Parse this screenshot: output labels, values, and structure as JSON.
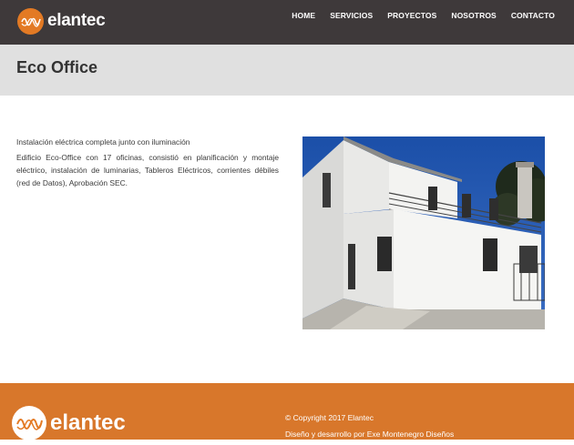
{
  "header": {
    "brand": "elantec",
    "nav": [
      "HOME",
      "SERVICIOS",
      "PROYECTOS",
      "NOSOTROS",
      "CONTACTO"
    ]
  },
  "page": {
    "title": "Eco Office"
  },
  "content": {
    "subtitle": "Instalación eléctrica completa junto con iluminación",
    "body": "Edificio Eco-Office con 17 oficinas, consistió en planificación y montaje eléctrico, instalación de luminarias, Tableros Eléctricos, corrientes débiles (red de Datos), Aprobación SEC."
  },
  "footer": {
    "brand": "elantec",
    "copyright": "© Copyright 2017 Elantec",
    "credits": "Diseño y desarrollo por Exe Montenegro Diseños"
  },
  "colors": {
    "header_bg": "#3e393a",
    "accent": "#e37a24",
    "title_bar_bg": "#e0e0e0",
    "footer_bg": "#d8772b"
  },
  "icons": [
    "elantec-logo-icon",
    "elantec-footer-logo-icon"
  ]
}
